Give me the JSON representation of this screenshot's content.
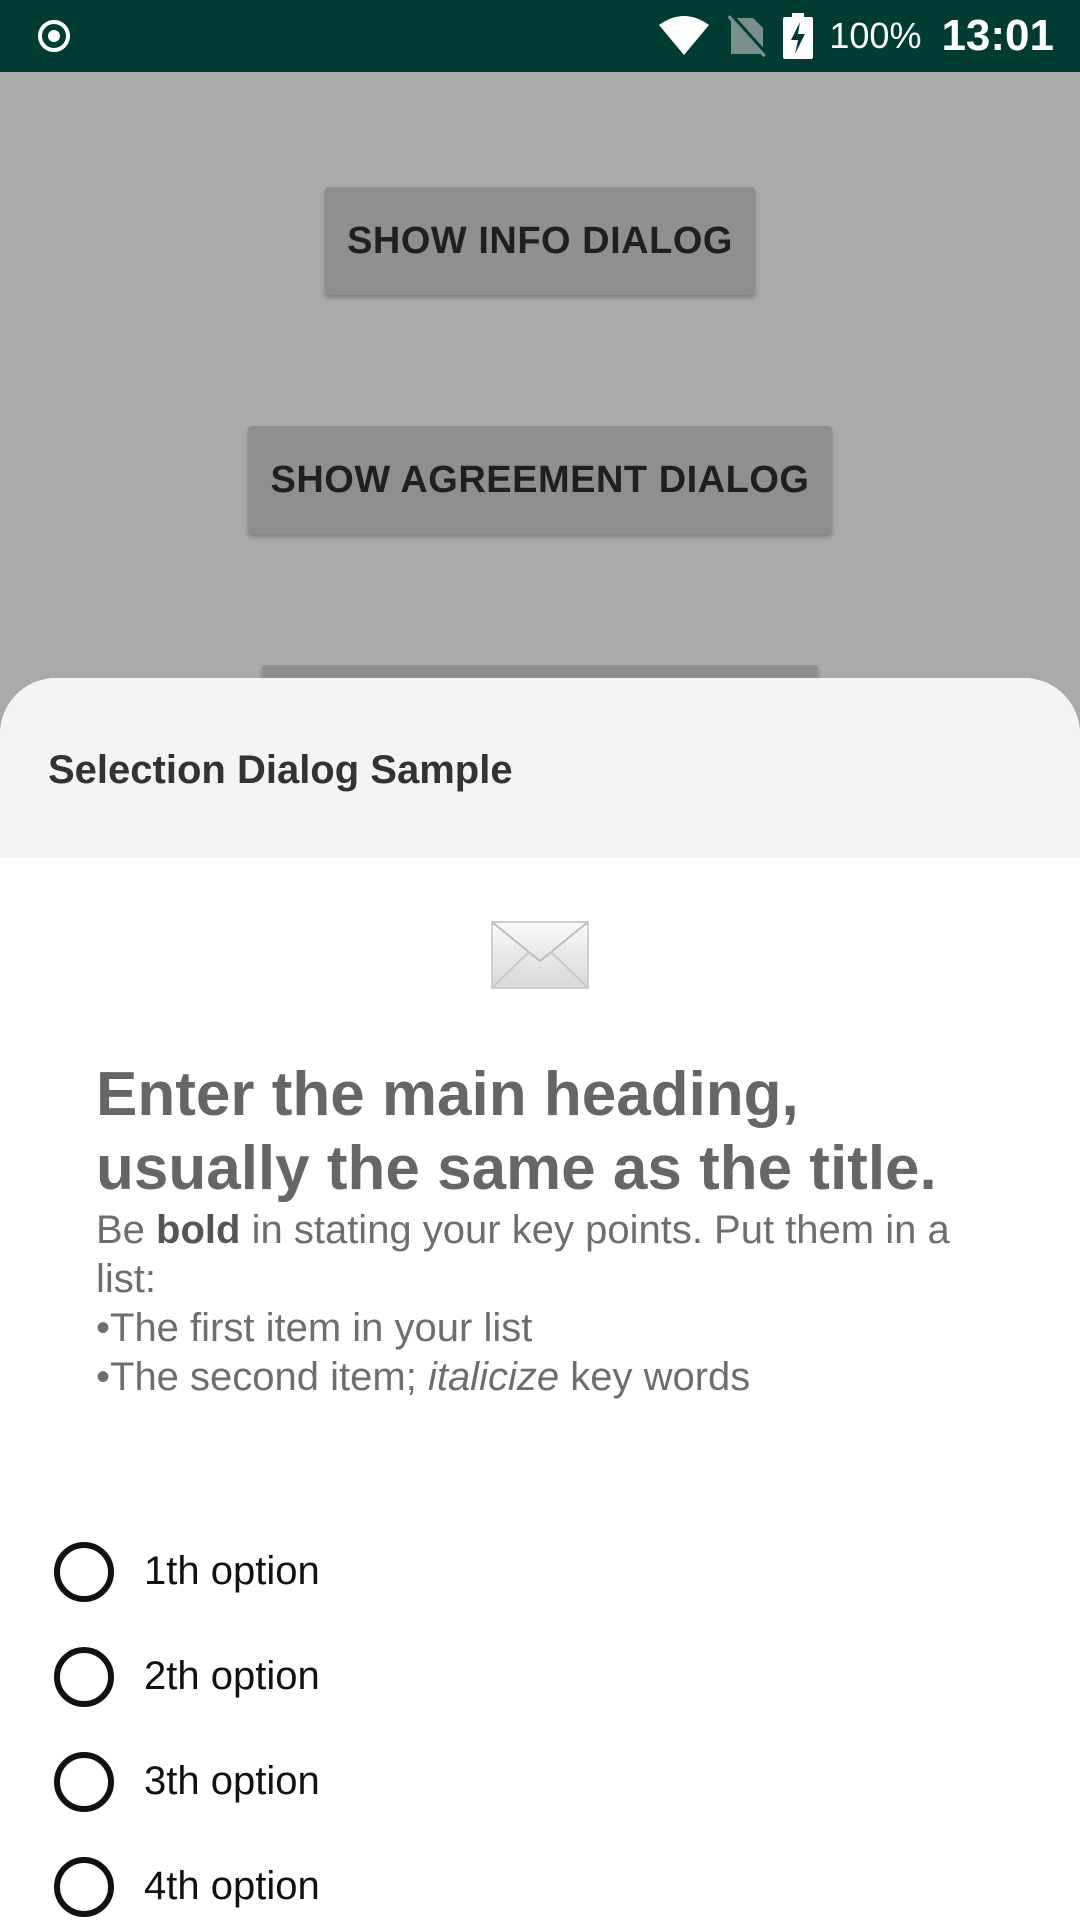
{
  "status_bar": {
    "left_icon": "record-icon",
    "battery_text": "100%",
    "clock": "13:01"
  },
  "background_buttons": {
    "info": "SHOW INFO DIALOG",
    "agreement": "SHOW AGREEMENT DIALOG"
  },
  "dialog": {
    "title": "Selection Dialog Sample",
    "icon": "envelope-icon",
    "heading": "Enter the main heading, usually the same as the title.",
    "body_prefix": "Be ",
    "body_bold": "bold",
    "body_suffix": " in stating your key points. Put them in a list:",
    "bullet_1": "•The first item in your list",
    "bullet_2_prefix": "•The second item; ",
    "bullet_2_italic": "italicize",
    "bullet_2_suffix": " key words",
    "options": [
      "1th option",
      "2th option",
      "3th option",
      "4th option"
    ]
  },
  "colors": {
    "status_bar": "#003b34",
    "scrim": "#aaaaaa",
    "header_bg": "#f4f4f4"
  }
}
